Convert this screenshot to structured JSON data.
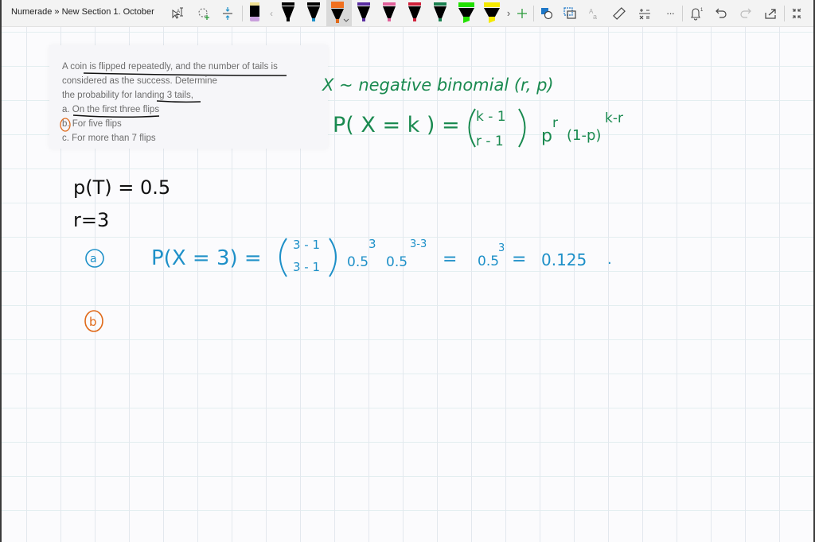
{
  "app": {
    "breadcrumb": "Numerade » New Section 1. October"
  },
  "toolbar": {
    "tools": [
      {
        "name": "lasso-select-text",
        "icon": "text-select-icon"
      },
      {
        "name": "lasso-select",
        "icon": "lasso-icon"
      },
      {
        "name": "add-space",
        "icon": "add-space-icon"
      }
    ],
    "pens": [
      {
        "name": "pen-black-purple",
        "color": "#000000",
        "tip": "#c9a0dc"
      },
      {
        "name": "pen-black",
        "color": "#000000",
        "tip": "#000000"
      },
      {
        "name": "pen-blue",
        "color": "#000000",
        "tip": "#1e90c8"
      },
      {
        "name": "pen-orange",
        "color": "#f07020",
        "tip": "#e06a1a",
        "selected": true
      },
      {
        "name": "pen-purple",
        "color": "#000000",
        "tip": "#5a2ea0"
      },
      {
        "name": "pen-pink",
        "color": "#000000",
        "tip": "#e0609a"
      },
      {
        "name": "pen-red",
        "color": "#000000",
        "tip": "#d0203a"
      },
      {
        "name": "pen-green",
        "color": "#000000",
        "tip": "#1a8050"
      },
      {
        "name": "highlighter-green",
        "color": "#22e000",
        "tip": "#22e000"
      },
      {
        "name": "highlighter-yellow",
        "color": "#f5ea00",
        "tip": "#f5ea00"
      }
    ],
    "actions": [
      {
        "name": "add-pen",
        "icon": "plus-icon"
      },
      {
        "name": "shapes",
        "icon": "shapes-icon"
      },
      {
        "name": "ink-to-shape",
        "icon": "ink-to-shape-icon"
      },
      {
        "name": "ink-to-text",
        "icon": "ink-to-text-icon"
      },
      {
        "name": "ruler",
        "icon": "ruler-icon"
      },
      {
        "name": "math",
        "icon": "math-icon"
      },
      {
        "name": "more",
        "icon": "more-icon"
      },
      {
        "name": "notifications",
        "icon": "bell-icon",
        "badge": "1"
      },
      {
        "name": "undo",
        "icon": "undo-icon"
      },
      {
        "name": "redo",
        "icon": "redo-icon"
      },
      {
        "name": "share",
        "icon": "share-icon"
      },
      {
        "name": "collapse",
        "icon": "collapse-icon"
      }
    ]
  },
  "question": {
    "lines": [
      "A coin is flipped repeatedly, and the number of tails is",
      "considered as the success. Determine",
      "the probability for landing 3 tails,",
      "a. On the first three flips",
      "b. For five flips",
      "c. For more than 7 flips"
    ]
  },
  "handwriting": {
    "green": {
      "color": "#1a8a50",
      "line1": "X ~ negative binomial (r, p)",
      "line2_lhs": "P( X = k ) =",
      "binom_top": "k - 1",
      "binom_bottom": "r - 1",
      "p": "p",
      "p_exp": "r",
      "q": "(1-p)",
      "q_exp": "k-r"
    },
    "black": {
      "color": "#111111",
      "line1": "p(T) = 0.5",
      "line2": "r=3"
    },
    "blue": {
      "color": "#1e90c8",
      "label": "a",
      "lhs": "P(X = 3) =",
      "binom_top": "3 - 1",
      "binom_bottom": "3 - 1",
      "t1": "0.5",
      "t1_exp": "3",
      "t2": "0.5",
      "t2_exp": "3-3",
      "eq2": "=",
      "t3": "0.5",
      "t3_exp": "3",
      "eq3": "=",
      "result": "0.125",
      "period": "."
    },
    "orange": {
      "color": "#e06a1a",
      "label": "b",
      "question_mark_label": "b"
    }
  }
}
